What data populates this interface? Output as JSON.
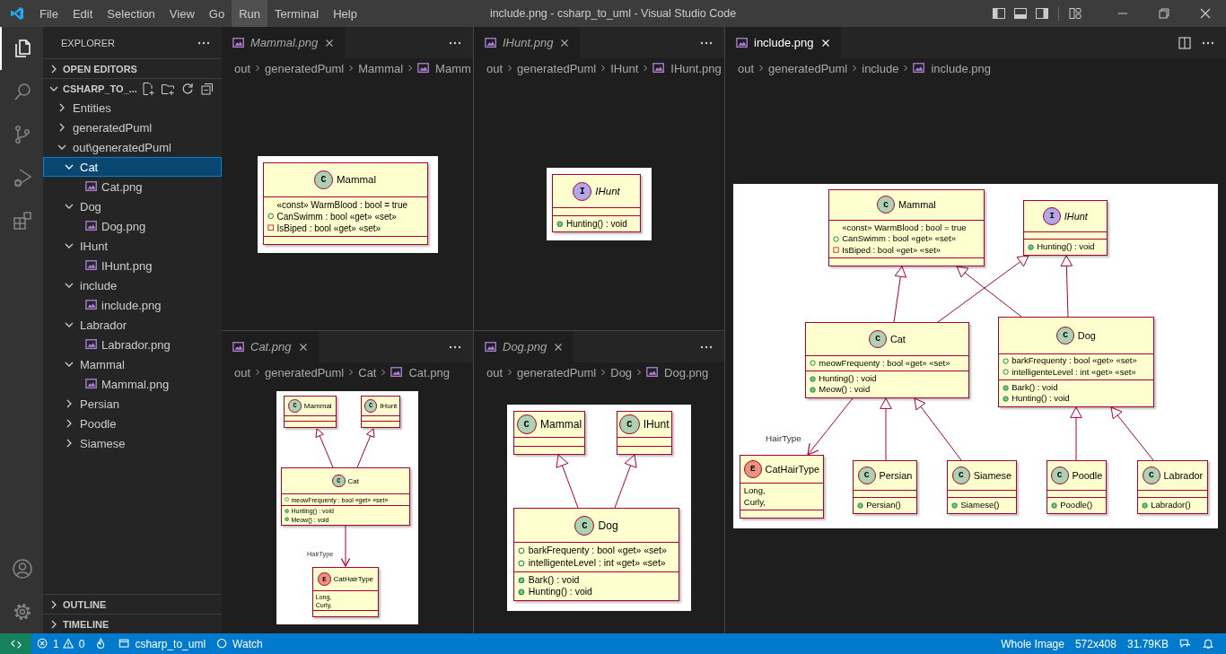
{
  "title_bar": {
    "menu": [
      {
        "label": "File",
        "selected": false
      },
      {
        "label": "Edit",
        "selected": false
      },
      {
        "label": "Selection",
        "selected": false
      },
      {
        "label": "View",
        "selected": false
      },
      {
        "label": "Go",
        "selected": false
      },
      {
        "label": "Run",
        "selected": true
      },
      {
        "label": "Terminal",
        "selected": false
      },
      {
        "label": "Help",
        "selected": false
      }
    ],
    "title": "include.png - csharp_to_uml - Visual Studio Code"
  },
  "activity_bar": {
    "items": [
      {
        "kind": "explorer",
        "selected": true
      },
      {
        "kind": "search",
        "selected": false
      },
      {
        "kind": "source_control",
        "selected": false
      },
      {
        "kind": "run_debug",
        "selected": false
      },
      {
        "kind": "extensions",
        "selected": false
      }
    ],
    "bottom": [
      {
        "kind": "account"
      },
      {
        "kind": "settings"
      }
    ]
  },
  "sidebar": {
    "title": "EXPLORER",
    "sections": [
      {
        "label": "OPEN EDITORS",
        "expanded": false
      },
      {
        "label": "CSHARP_TO_...",
        "expanded": true,
        "tree": [
          {
            "kind": "folder",
            "label": "Entities",
            "expanded": false,
            "selected": false
          },
          {
            "kind": "folder",
            "label": "generatedPuml",
            "expanded": false,
            "selected": false
          },
          {
            "kind": "folder",
            "label": "out\\generatedPuml",
            "expanded": true,
            "selected": false,
            "children": [
              {
                "kind": "folder",
                "label": "Cat",
                "expanded": true,
                "selected": true,
                "children": [
                  {
                    "kind": "file",
                    "label": "Cat.png",
                    "selected": false
                  }
                ]
              },
              {
                "kind": "folder",
                "label": "Dog",
                "expanded": true,
                "selected": false,
                "children": [
                  {
                    "kind": "file",
                    "label": "Dog.png",
                    "selected": false
                  }
                ]
              },
              {
                "kind": "folder",
                "label": "IHunt",
                "expanded": true,
                "selected": false,
                "children": [
                  {
                    "kind": "file",
                    "label": "IHunt.png",
                    "selected": false
                  }
                ]
              },
              {
                "kind": "folder",
                "label": "include",
                "expanded": true,
                "selected": false,
                "children": [
                  {
                    "kind": "file",
                    "label": "include.png",
                    "selected": false
                  }
                ]
              },
              {
                "kind": "folder",
                "label": "Labrador",
                "expanded": true,
                "selected": false,
                "children": [
                  {
                    "kind": "file",
                    "label": "Labrador.png",
                    "selected": false
                  }
                ]
              },
              {
                "kind": "folder",
                "label": "Mammal",
                "expanded": true,
                "selected": false,
                "children": [
                  {
                    "kind": "file",
                    "label": "Mammal.png",
                    "selected": false
                  }
                ]
              },
              {
                "kind": "folder",
                "label": "Persian",
                "expanded": false,
                "selected": false
              },
              {
                "kind": "folder",
                "label": "Poodle",
                "expanded": false,
                "selected": false
              },
              {
                "kind": "folder",
                "label": "Siamese",
                "expanded": false,
                "selected": false
              }
            ]
          }
        ]
      }
    ],
    "bottom_sections": [
      {
        "label": "OUTLINE",
        "expanded": false
      },
      {
        "label": "TIMELINE",
        "expanded": false
      }
    ]
  },
  "editor_groups": [
    {
      "panes": [
        {
          "tab": {
            "label": "Mammal.png",
            "preview": true,
            "selected": false
          },
          "breadcrumbs": [
            {
              "kind": "folder",
              "label": "out"
            },
            {
              "kind": "folder",
              "label": "generatedPuml"
            },
            {
              "kind": "folder",
              "label": "Mammal"
            },
            {
              "kind": "file",
              "label": "Mamm"
            }
          ],
          "image": {
            "nodes": [
              {
                "kind": "class",
                "badge": "C",
                "name": "Mammal",
                "fields": [
                  {
                    "kind": "plain",
                    "text": "«const» WarmBlood : bool = true"
                  },
                  {
                    "kind": "public",
                    "text": "CanSwimm : bool «get» «set»"
                  },
                  {
                    "kind": "private",
                    "text": "IsBiped : bool «get» «set»"
                  }
                ]
              }
            ]
          }
        },
        {
          "tab": {
            "label": "Cat.png",
            "preview": true,
            "selected": false
          },
          "breadcrumbs": [
            {
              "kind": "folder",
              "label": "out"
            },
            {
              "kind": "folder",
              "label": "generatedPuml"
            },
            {
              "kind": "folder",
              "label": "Cat"
            },
            {
              "kind": "file",
              "label": "Cat.png"
            }
          ],
          "image": {
            "nodes": [
              {
                "kind": "class",
                "badge": "C",
                "name": "Mammal"
              },
              {
                "kind": "class",
                "badge": "C",
                "name": "IHunt"
              },
              {
                "kind": "class",
                "badge": "C",
                "name": "Cat",
                "fields": [
                  {
                    "kind": "public",
                    "text": "meowFrequenty : bool «get» «set»"
                  }
                ],
                "methods": [
                  {
                    "kind": "method",
                    "text": "Hunting() : void"
                  },
                  {
                    "kind": "method",
                    "text": "Meow() : void"
                  }
                ]
              },
              {
                "kind": "enum",
                "badge": "E",
                "name": "CatHairType",
                "role_label": "HairType",
                "values": [
                  {
                    "kind": "literal",
                    "text": "Long,"
                  },
                  {
                    "kind": "literal",
                    "text": "Curly,"
                  }
                ]
              }
            ]
          }
        }
      ]
    },
    {
      "panes": [
        {
          "tab": {
            "label": "IHunt.png",
            "preview": true,
            "selected": false
          },
          "breadcrumbs": [
            {
              "kind": "folder",
              "label": "out"
            },
            {
              "kind": "folder",
              "label": "generatedPuml"
            },
            {
              "kind": "folder",
              "label": "IHunt"
            },
            {
              "kind": "file",
              "label": "IHunt.png"
            }
          ],
          "image": {
            "nodes": [
              {
                "kind": "interface",
                "badge": "I",
                "name": "IHunt",
                "methods": [
                  {
                    "kind": "method",
                    "text": "Hunting() : void"
                  }
                ]
              }
            ]
          }
        },
        {
          "tab": {
            "label": "Dog.png",
            "preview": true,
            "selected": false
          },
          "breadcrumbs": [
            {
              "kind": "folder",
              "label": "out"
            },
            {
              "kind": "folder",
              "label": "generatedPuml"
            },
            {
              "kind": "folder",
              "label": "Dog"
            },
            {
              "kind": "file",
              "label": "Dog.png"
            }
          ],
          "image": {
            "nodes": [
              {
                "kind": "class",
                "badge": "C",
                "name": "Mammal"
              },
              {
                "kind": "class",
                "badge": "C",
                "name": "IHunt"
              },
              {
                "kind": "class",
                "badge": "C",
                "name": "Dog",
                "fields": [
                  {
                    "kind": "public",
                    "text": "barkFrequenty : bool «get» «set»"
                  },
                  {
                    "kind": "public",
                    "text": "intelligenteLevel : int «get» «set»"
                  }
                ],
                "methods": [
                  {
                    "kind": "method",
                    "text": "Bark() : void"
                  },
                  {
                    "kind": "method",
                    "text": "Hunting() : void"
                  }
                ]
              }
            ]
          }
        }
      ]
    },
    {
      "panes": [
        {
          "tab": {
            "label": "include.png",
            "preview": false,
            "selected": true
          },
          "breadcrumbs": [
            {
              "kind": "folder",
              "label": "out"
            },
            {
              "kind": "folder",
              "label": "generatedPuml"
            },
            {
              "kind": "folder",
              "label": "include"
            },
            {
              "kind": "file",
              "label": "include.png"
            }
          ],
          "image": {
            "nodes": [
              {
                "kind": "class",
                "badge": "C",
                "name": "Mammal",
                "fields": [
                  {
                    "kind": "plain",
                    "text": "«const» WarmBlood : bool = true"
                  },
                  {
                    "kind": "public",
                    "text": "CanSwimm : bool «get» «set»"
                  },
                  {
                    "kind": "private",
                    "text": "IsBiped : bool «get» «set»"
                  }
                ]
              },
              {
                "kind": "interface",
                "badge": "I",
                "name": "IHunt",
                "methods": [
                  {
                    "kind": "method",
                    "text": "Hunting() : void"
                  }
                ]
              },
              {
                "kind": "class",
                "badge": "C",
                "name": "Cat",
                "fields": [
                  {
                    "kind": "public",
                    "text": "meowFrequenty : bool «get» «set»"
                  }
                ],
                "methods": [
                  {
                    "kind": "method",
                    "text": "Hunting() : void"
                  },
                  {
                    "kind": "method",
                    "text": "Meow() : void"
                  }
                ]
              },
              {
                "kind": "class",
                "badge": "C",
                "name": "Dog",
                "fields": [
                  {
                    "kind": "public",
                    "text": "barkFrequenty : bool «get» «set»"
                  },
                  {
                    "kind": "public",
                    "text": "intelligenteLevel : int «get» «set»"
                  }
                ],
                "methods": [
                  {
                    "kind": "method",
                    "text": "Bark() : void"
                  },
                  {
                    "kind": "method",
                    "text": "Hunting() : void"
                  }
                ]
              },
              {
                "kind": "enum",
                "badge": "E",
                "name": "CatHairType",
                "role_label": "HairType",
                "values": [
                  {
                    "kind": "literal",
                    "text": "Long,"
                  },
                  {
                    "kind": "literal",
                    "text": "Curly,"
                  }
                ]
              },
              {
                "kind": "class",
                "badge": "C",
                "name": "Persian",
                "methods": [
                  {
                    "kind": "method",
                    "text": "Persian()"
                  }
                ]
              },
              {
                "kind": "class",
                "badge": "C",
                "name": "Siamese",
                "methods": [
                  {
                    "kind": "method",
                    "text": "Siamese()"
                  }
                ]
              },
              {
                "kind": "class",
                "badge": "C",
                "name": "Poodle",
                "methods": [
                  {
                    "kind": "method",
                    "text": "Poodle()"
                  }
                ]
              },
              {
                "kind": "class",
                "badge": "C",
                "name": "Labrador",
                "methods": [
                  {
                    "kind": "method",
                    "text": "Labrador()"
                  }
                ]
              }
            ]
          }
        }
      ]
    }
  ],
  "status_bar": {
    "left": [
      {
        "kind": "remote"
      },
      {
        "kind": "problems",
        "errors": "1",
        "warnings": "0"
      },
      {
        "kind": "flame"
      },
      {
        "kind": "folder",
        "label": "csharp_to_uml"
      },
      {
        "kind": "watch",
        "label": "Watch"
      }
    ],
    "right": [
      {
        "kind": "text",
        "label": "Whole Image"
      },
      {
        "kind": "text",
        "label": "572x408"
      },
      {
        "kind": "text",
        "label": "31.79KB"
      },
      {
        "kind": "feedback"
      },
      {
        "kind": "bell"
      }
    ]
  }
}
